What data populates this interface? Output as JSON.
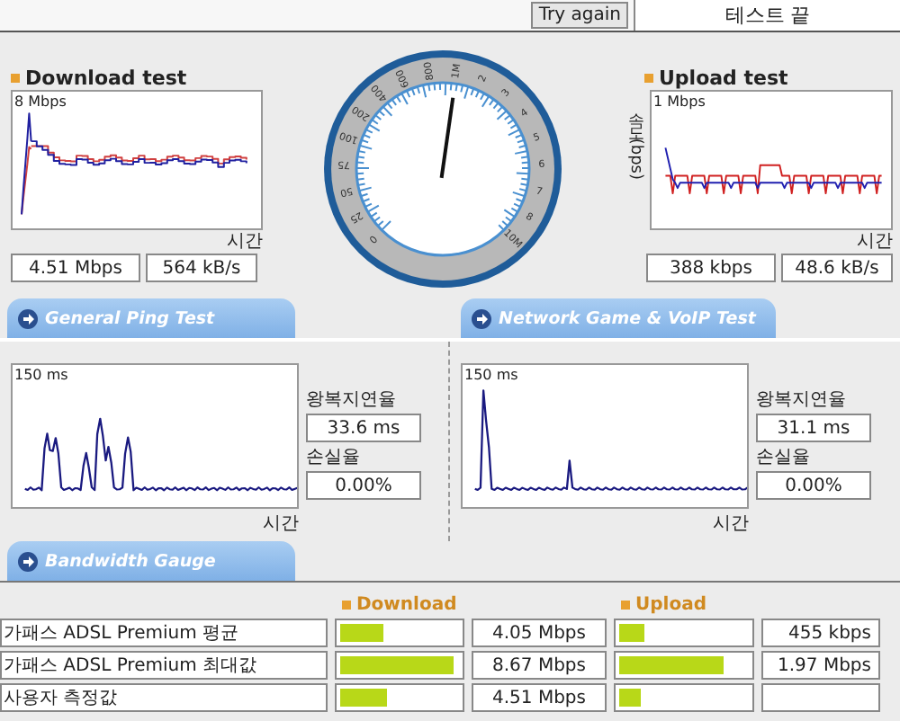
{
  "top_bar": {
    "button": "Try again",
    "status": "테스트 끝"
  },
  "download": {
    "title": "Download test",
    "scale": "8 Mbps",
    "x_label": "시간",
    "values": [
      "4.51 Mbps",
      "564 kB/s"
    ]
  },
  "gauge": {
    "labels": [
      "0",
      "25",
      "50",
      "75",
      "100",
      "200",
      "400",
      "600",
      "800",
      "1M",
      "2",
      "3",
      "4",
      "5",
      "6",
      "7",
      "8",
      "10M"
    ]
  },
  "upload": {
    "title": "Upload test",
    "y_label": "속도 (bps)",
    "scale": "1 Mbps",
    "x_label": "시간",
    "values": [
      "388 kbps",
      "48.6 kB/s"
    ]
  },
  "ping_tests": [
    {
      "heading": "General Ping Test",
      "scale": "150 ms",
      "x_label": "시간",
      "latency_label": "왕복지연율",
      "latency": "33.6 ms",
      "loss_label": "손실율",
      "loss": "0.00%"
    },
    {
      "heading": "Network Game & VoIP Test",
      "scale": "150 ms",
      "x_label": "시간",
      "latency_label": "왕복지연율",
      "latency": "31.1 ms",
      "loss_label": "손실율",
      "loss": "0.00%"
    }
  ],
  "bandwidth": {
    "heading": "Bandwidth Gauge",
    "columns": [
      "Download",
      "Upload"
    ],
    "rows": [
      {
        "label": "가패스 ADSL Premium 평균",
        "download_bar": {
          "level": 0.37
        },
        "download": "4.05 Mbps",
        "upload_bar": {
          "level": 0.19
        },
        "upload": "455 kbps"
      },
      {
        "label": "가패스 ADSL Premium 최대값",
        "download_bar": {
          "level": 0.95
        },
        "download": "8.67 Mbps",
        "upload_bar": {
          "level": 0.81
        },
        "upload": "1.97 Mbps"
      },
      {
        "label": "사용자 측정값",
        "download_bar": {
          "level": 0.4
        },
        "download": "4.51 Mbps",
        "upload_bar": {
          "level": 0.17
        }
      }
    ]
  }
}
